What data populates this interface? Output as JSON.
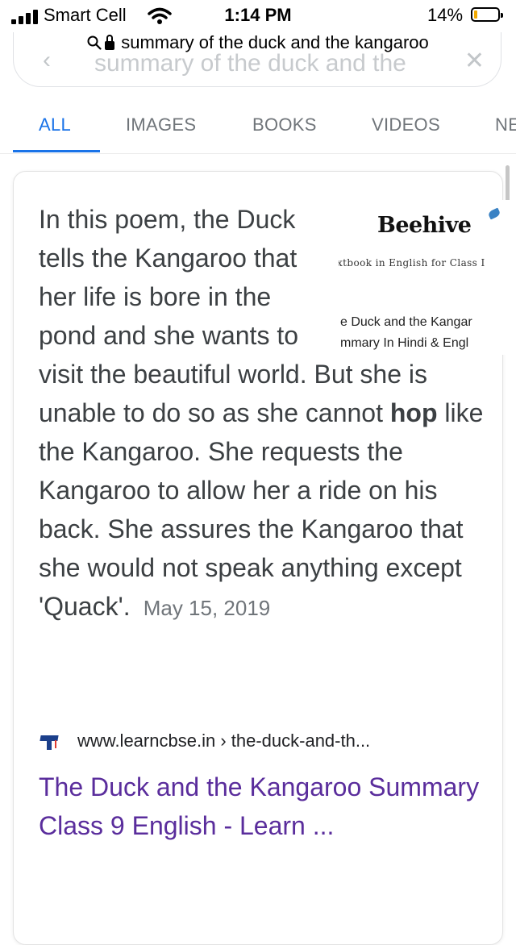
{
  "status_bar": {
    "carrier": "Smart Cell",
    "time": "1:14 PM",
    "battery": "14%",
    "battery_level": 0.14
  },
  "url_bar": {
    "text": "summary of the duck and the kangaroo"
  },
  "search_box": {
    "value": "summary of the duck and the"
  },
  "tabs": [
    {
      "label": "ALL",
      "active": true
    },
    {
      "label": "IMAGES",
      "active": false
    },
    {
      "label": "BOOKS",
      "active": false
    },
    {
      "label": "VIDEOS",
      "active": false
    },
    {
      "label": "NE",
      "active": false
    }
  ],
  "featured_snippet": {
    "text_part1": "In this poem, the Duck tells the Kangaroo that her life is bore in the pond and she wants to visit the beautiful world. But she is unable to do so as she cannot ",
    "bold": "hop",
    "text_part2": " like the Kangaroo. She requests the Kangaroo to allow her a ride on his back. She assures the Kangaroo that she would not speak anything except 'Quack'.",
    "date": "May 15, 2019",
    "thumbnail": {
      "title": "Beehive",
      "subtitle": "xtbook in English for Class I",
      "line1": "e Duck and the Kangar",
      "line2": "mmary In Hindi & Engl"
    }
  },
  "source": {
    "domain": "www.learncbse.in",
    "path": "› the-duck-and-th...",
    "icon": "graduation-cap-icon"
  },
  "result_title": "The Duck and the Kangaroo Summary Class 9 English - Learn ...",
  "colors": {
    "accent": "#1a73e8",
    "link_visited": "#5a2d9c",
    "battery": "#f2a900"
  }
}
